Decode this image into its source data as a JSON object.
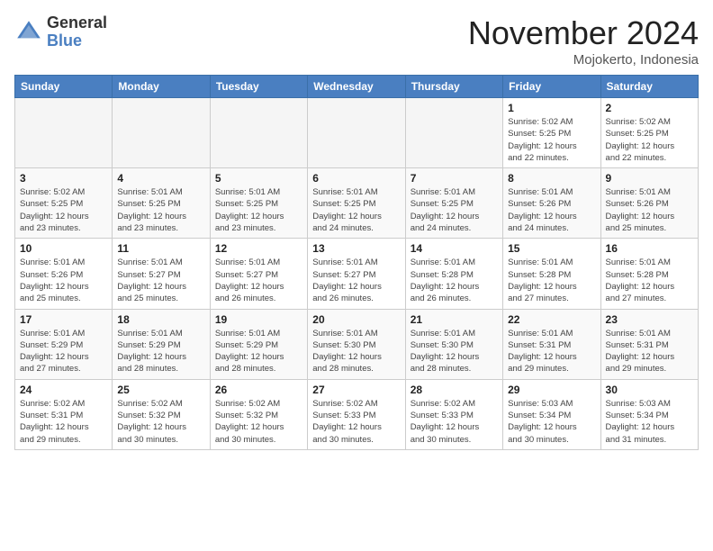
{
  "header": {
    "logo_general": "General",
    "logo_blue": "Blue",
    "month_title": "November 2024",
    "location": "Mojokerto, Indonesia"
  },
  "weekdays": [
    "Sunday",
    "Monday",
    "Tuesday",
    "Wednesday",
    "Thursday",
    "Friday",
    "Saturday"
  ],
  "weeks": [
    [
      {
        "day": "",
        "info": ""
      },
      {
        "day": "",
        "info": ""
      },
      {
        "day": "",
        "info": ""
      },
      {
        "day": "",
        "info": ""
      },
      {
        "day": "",
        "info": ""
      },
      {
        "day": "1",
        "info": "Sunrise: 5:02 AM\nSunset: 5:25 PM\nDaylight: 12 hours\nand 22 minutes."
      },
      {
        "day": "2",
        "info": "Sunrise: 5:02 AM\nSunset: 5:25 PM\nDaylight: 12 hours\nand 22 minutes."
      }
    ],
    [
      {
        "day": "3",
        "info": "Sunrise: 5:02 AM\nSunset: 5:25 PM\nDaylight: 12 hours\nand 23 minutes."
      },
      {
        "day": "4",
        "info": "Sunrise: 5:01 AM\nSunset: 5:25 PM\nDaylight: 12 hours\nand 23 minutes."
      },
      {
        "day": "5",
        "info": "Sunrise: 5:01 AM\nSunset: 5:25 PM\nDaylight: 12 hours\nand 23 minutes."
      },
      {
        "day": "6",
        "info": "Sunrise: 5:01 AM\nSunset: 5:25 PM\nDaylight: 12 hours\nand 24 minutes."
      },
      {
        "day": "7",
        "info": "Sunrise: 5:01 AM\nSunset: 5:25 PM\nDaylight: 12 hours\nand 24 minutes."
      },
      {
        "day": "8",
        "info": "Sunrise: 5:01 AM\nSunset: 5:26 PM\nDaylight: 12 hours\nand 24 minutes."
      },
      {
        "day": "9",
        "info": "Sunrise: 5:01 AM\nSunset: 5:26 PM\nDaylight: 12 hours\nand 25 minutes."
      }
    ],
    [
      {
        "day": "10",
        "info": "Sunrise: 5:01 AM\nSunset: 5:26 PM\nDaylight: 12 hours\nand 25 minutes."
      },
      {
        "day": "11",
        "info": "Sunrise: 5:01 AM\nSunset: 5:27 PM\nDaylight: 12 hours\nand 25 minutes."
      },
      {
        "day": "12",
        "info": "Sunrise: 5:01 AM\nSunset: 5:27 PM\nDaylight: 12 hours\nand 26 minutes."
      },
      {
        "day": "13",
        "info": "Sunrise: 5:01 AM\nSunset: 5:27 PM\nDaylight: 12 hours\nand 26 minutes."
      },
      {
        "day": "14",
        "info": "Sunrise: 5:01 AM\nSunset: 5:28 PM\nDaylight: 12 hours\nand 26 minutes."
      },
      {
        "day": "15",
        "info": "Sunrise: 5:01 AM\nSunset: 5:28 PM\nDaylight: 12 hours\nand 27 minutes."
      },
      {
        "day": "16",
        "info": "Sunrise: 5:01 AM\nSunset: 5:28 PM\nDaylight: 12 hours\nand 27 minutes."
      }
    ],
    [
      {
        "day": "17",
        "info": "Sunrise: 5:01 AM\nSunset: 5:29 PM\nDaylight: 12 hours\nand 27 minutes."
      },
      {
        "day": "18",
        "info": "Sunrise: 5:01 AM\nSunset: 5:29 PM\nDaylight: 12 hours\nand 28 minutes."
      },
      {
        "day": "19",
        "info": "Sunrise: 5:01 AM\nSunset: 5:29 PM\nDaylight: 12 hours\nand 28 minutes."
      },
      {
        "day": "20",
        "info": "Sunrise: 5:01 AM\nSunset: 5:30 PM\nDaylight: 12 hours\nand 28 minutes."
      },
      {
        "day": "21",
        "info": "Sunrise: 5:01 AM\nSunset: 5:30 PM\nDaylight: 12 hours\nand 28 minutes."
      },
      {
        "day": "22",
        "info": "Sunrise: 5:01 AM\nSunset: 5:31 PM\nDaylight: 12 hours\nand 29 minutes."
      },
      {
        "day": "23",
        "info": "Sunrise: 5:01 AM\nSunset: 5:31 PM\nDaylight: 12 hours\nand 29 minutes."
      }
    ],
    [
      {
        "day": "24",
        "info": "Sunrise: 5:02 AM\nSunset: 5:31 PM\nDaylight: 12 hours\nand 29 minutes."
      },
      {
        "day": "25",
        "info": "Sunrise: 5:02 AM\nSunset: 5:32 PM\nDaylight: 12 hours\nand 30 minutes."
      },
      {
        "day": "26",
        "info": "Sunrise: 5:02 AM\nSunset: 5:32 PM\nDaylight: 12 hours\nand 30 minutes."
      },
      {
        "day": "27",
        "info": "Sunrise: 5:02 AM\nSunset: 5:33 PM\nDaylight: 12 hours\nand 30 minutes."
      },
      {
        "day": "28",
        "info": "Sunrise: 5:02 AM\nSunset: 5:33 PM\nDaylight: 12 hours\nand 30 minutes."
      },
      {
        "day": "29",
        "info": "Sunrise: 5:03 AM\nSunset: 5:34 PM\nDaylight: 12 hours\nand 30 minutes."
      },
      {
        "day": "30",
        "info": "Sunrise: 5:03 AM\nSunset: 5:34 PM\nDaylight: 12 hours\nand 31 minutes."
      }
    ]
  ]
}
